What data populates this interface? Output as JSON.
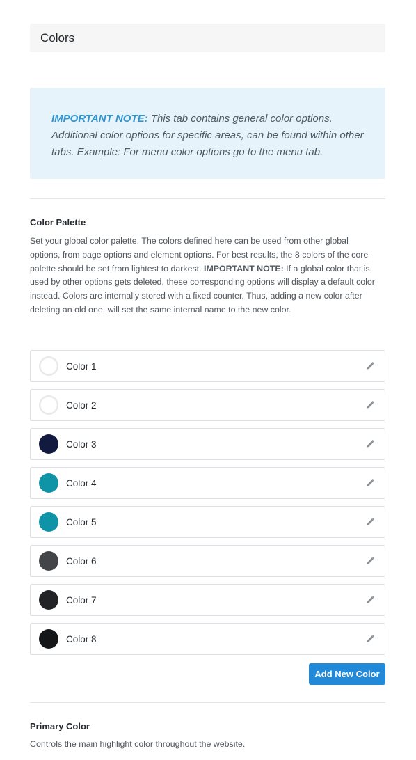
{
  "header": {
    "title": "Colors"
  },
  "note": {
    "label": "IMPORTANT NOTE:",
    "text": " This tab contains general color options. Additional color options for specific areas, can be found within other tabs. Example: For menu color options go to the menu tab."
  },
  "palette": {
    "title": "Color Palette",
    "description_pre": "Set your global color palette. The colors defined here can be used from other global options, from page options and element options. For best results, the 8 colors of the core palette should be set from lightest to darkest. ",
    "description_bold": "IMPORTANT NOTE:",
    "description_post": " If a global color that is used by other options gets deleted, these corresponding options will display a default color instead. Colors are internally stored with a fixed counter. Thus, adding a new color after deleting an old one, will set the same internal name to the new color.",
    "colors": [
      {
        "label": "Color 1",
        "hex": "#ffffff"
      },
      {
        "label": "Color 2",
        "hex": "#ffffff"
      },
      {
        "label": "Color 3",
        "hex": "#131a3f"
      },
      {
        "label": "Color 4",
        "hex": "#0f93a6"
      },
      {
        "label": "Color 5",
        "hex": "#0f93a6"
      },
      {
        "label": "Color 6",
        "hex": "#434549"
      },
      {
        "label": "Color 7",
        "hex": "#212326"
      },
      {
        "label": "Color 8",
        "hex": "#141617"
      }
    ],
    "edit_icon": "pencil-icon",
    "add_button_label": "Add New Color"
  },
  "primary": {
    "title": "Primary Color",
    "description": "Controls the main highlight color throughout the website."
  },
  "accent": "#2189d8"
}
